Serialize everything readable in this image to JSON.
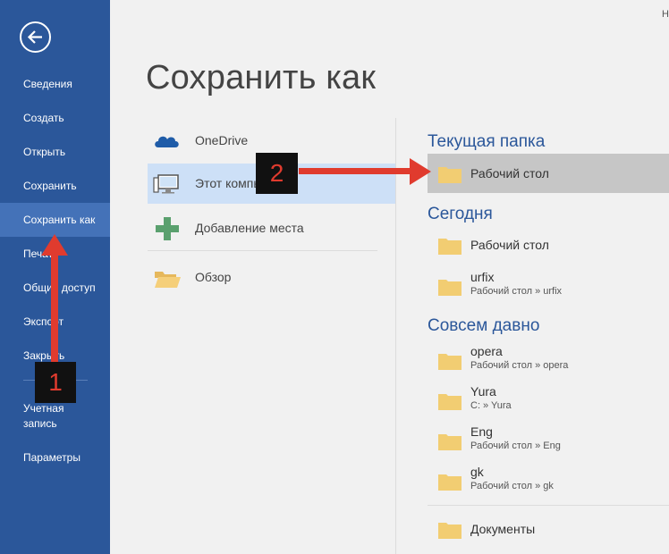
{
  "corner": {
    "text": "Н"
  },
  "sidebar": {
    "items": [
      {
        "label": "Сведения"
      },
      {
        "label": "Создать"
      },
      {
        "label": "Открыть"
      },
      {
        "label": "Сохранить"
      },
      {
        "label": "Сохранить как"
      },
      {
        "label": "Печать"
      },
      {
        "label": "Общий доступ"
      },
      {
        "label": "Экспорт"
      },
      {
        "label": "Закрыть"
      },
      {
        "label": "Учетная запись"
      },
      {
        "label": "Параметры"
      }
    ]
  },
  "page": {
    "title": "Сохранить как"
  },
  "locations": [
    {
      "label": "OneDrive",
      "icon": "cloud-icon"
    },
    {
      "label": "Этот компьютер",
      "icon": "computer-icon"
    },
    {
      "label": "Добавление места",
      "icon": "plus-icon"
    },
    {
      "label": "Обзор",
      "icon": "folder-open-icon"
    }
  ],
  "sections": {
    "current": {
      "title": "Текущая папка",
      "folders": [
        {
          "name": "Рабочий стол"
        }
      ]
    },
    "today": {
      "title": "Сегодня",
      "folders": [
        {
          "name": "Рабочий стол"
        },
        {
          "name": "urfix",
          "path": "Рабочий стол » urfix"
        }
      ]
    },
    "older": {
      "title": "Совсем давно",
      "folders": [
        {
          "name": "opera",
          "path": "Рабочий стол » opera"
        },
        {
          "name": "Yura",
          "path": "C: » Yura"
        },
        {
          "name": "Eng",
          "path": "Рабочий стол » Eng"
        },
        {
          "name": "gk",
          "path": "Рабочий стол » gk"
        }
      ]
    },
    "bottom": {
      "folders": [
        {
          "name": "Документы"
        }
      ]
    }
  },
  "annotations": {
    "badge1": "1",
    "badge2": "2",
    "color": "#e03b2e"
  },
  "colors": {
    "sidebar": "#2b579a",
    "sidebar_active": "#4472b8",
    "selected_location": "#cde0f7",
    "highlight_folder": "#c6c6c6",
    "section_title": "#2b579a"
  }
}
